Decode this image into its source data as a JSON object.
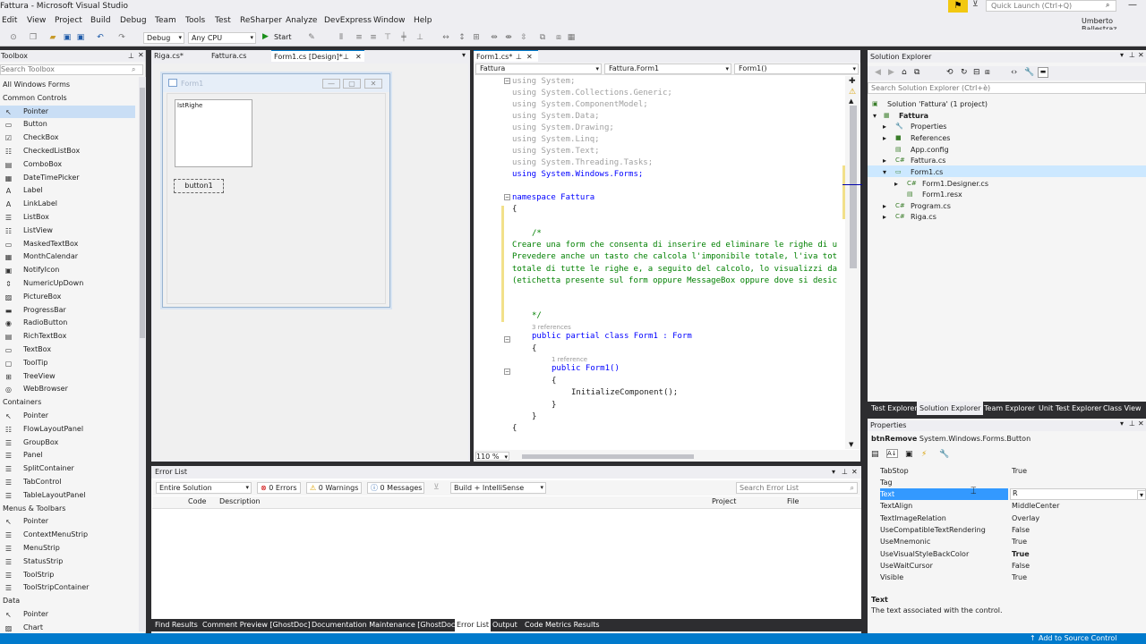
{
  "window": {
    "title": "Fattura - Microsoft Visual Studio",
    "quick_launch_placeholder": "Quick Launch (Ctrl+Q)",
    "user": "Umberto Ballestraz"
  },
  "menu": [
    "Edit",
    "View",
    "Project",
    "Build",
    "Debug",
    "Team",
    "Tools",
    "Test",
    "ReSharper",
    "Analyze",
    "DevExpress",
    "Window",
    "Help"
  ],
  "toolbar": {
    "config": "Debug",
    "platform": "Any CPU",
    "start": "Start"
  },
  "toolbox": {
    "title": "Toolbox",
    "search_placeholder": "Search Toolbox",
    "groups": [
      {
        "name": "All Windows Forms"
      },
      {
        "name": "Common Controls"
      }
    ],
    "common": [
      {
        "icon": "pointer",
        "label": "Pointer"
      },
      {
        "icon": "button",
        "label": "Button"
      },
      {
        "icon": "checkbox",
        "label": "CheckBox"
      },
      {
        "icon": "checkedlistbox",
        "label": "CheckedListBox"
      },
      {
        "icon": "combobox",
        "label": "ComboBox"
      },
      {
        "icon": "datetimepicker",
        "label": "DateTimePicker"
      },
      {
        "icon": "label",
        "label": "Label"
      },
      {
        "icon": "linklabel",
        "label": "LinkLabel"
      },
      {
        "icon": "listbox",
        "label": "ListBox"
      },
      {
        "icon": "listview",
        "label": "ListView"
      },
      {
        "icon": "maskedtextbox",
        "label": "MaskedTextBox"
      },
      {
        "icon": "monthcalendar",
        "label": "MonthCalendar"
      },
      {
        "icon": "notifyicon",
        "label": "NotifyIcon"
      },
      {
        "icon": "numericupdown",
        "label": "NumericUpDown"
      },
      {
        "icon": "picturebox",
        "label": "PictureBox"
      },
      {
        "icon": "progressbar",
        "label": "ProgressBar"
      },
      {
        "icon": "radiobutton",
        "label": "RadioButton"
      },
      {
        "icon": "richtextbox",
        "label": "RichTextBox"
      },
      {
        "icon": "textbox",
        "label": "TextBox"
      },
      {
        "icon": "tooltip",
        "label": "ToolTip"
      },
      {
        "icon": "treeview",
        "label": "TreeView"
      },
      {
        "icon": "webbrowser",
        "label": "WebBrowser"
      }
    ],
    "containers_label": "Containers",
    "containers": [
      "Pointer",
      "FlowLayoutPanel",
      "GroupBox",
      "Panel",
      "SplitContainer",
      "TabControl",
      "TableLayoutPanel"
    ],
    "menus_label": "Menus & Toolbars",
    "menus": [
      "Pointer",
      "ContextMenuStrip",
      "MenuStrip",
      "StatusStrip",
      "ToolStrip",
      "ToolStripContainer"
    ],
    "data_label": "Data",
    "data": [
      "Pointer",
      "Chart"
    ]
  },
  "designer_tabs": [
    "Riga.cs*",
    "Fattura.cs",
    "Form1.cs [Design]*"
  ],
  "form": {
    "title": "Form1",
    "listbox": "lstRighe",
    "button": "button1"
  },
  "editor": {
    "tab": "Form1.cs*",
    "nav": [
      "Fattura",
      "Fattura.Form1",
      "Form1()"
    ],
    "zoom": "110 %",
    "lines": [
      {
        "t": "using System;"
      },
      {
        "t": "using System.Collections.Generic;"
      },
      {
        "t": "using System.ComponentModel;"
      },
      {
        "t": "using System.Data;"
      },
      {
        "t": "using System.Drawing;"
      },
      {
        "t": "using System.Linq;"
      },
      {
        "t": "using System.Text;"
      },
      {
        "t": "using System.Threading.Tasks;"
      },
      {
        "t": "using System.Windows.Forms;"
      },
      {
        "t": "namespace Fattura"
      },
      {
        "t": "{"
      },
      {
        "t": "/*"
      },
      {
        "t": "Creare una form che consenta di inserire ed eliminare le righe di u"
      },
      {
        "t": "Prevedere anche un tasto che calcola l'imponibile totale, l'iva tot"
      },
      {
        "t": "totale di tutte le righe e, a seguito del calcolo, lo visualizzi da"
      },
      {
        "t": "(etichetta presente sul form oppure MessageBox oppure dove si desic"
      },
      {
        "t": "*/"
      },
      {
        "t": "3 references"
      },
      {
        "t": "public partial class Form1 : Form"
      },
      {
        "t": "{"
      },
      {
        "t": "1 reference"
      },
      {
        "t": "public Form1()"
      },
      {
        "t": "{"
      },
      {
        "t": "InitializeComponent();"
      },
      {
        "t": "}"
      },
      {
        "t": "}"
      }
    ]
  },
  "solution": {
    "title": "Solution Explorer",
    "search_placeholder": "Search Solution Explorer (Ctrl+è)",
    "tree": [
      "Solution 'Fattura' (1 project)",
      "Fattura",
      "Properties",
      "References",
      "App.config",
      "Fattura.cs",
      "Form1.cs",
      "Form1.Designer.cs",
      "Form1.resx",
      "Program.cs",
      "Riga.cs"
    ],
    "tabs": [
      "Test Explorer",
      "Solution Explorer",
      "Team Explorer",
      "Unit Test Explorer",
      "Class View"
    ]
  },
  "properties": {
    "title": "Properties",
    "object": "btnRemove",
    "object_type": "System.Windows.Forms.Button",
    "rows": [
      {
        "n": "TabStop",
        "v": "True"
      },
      {
        "n": "Tag",
        "v": ""
      },
      {
        "n": "Text",
        "v": "R"
      },
      {
        "n": "TextAlign",
        "v": "MiddleCenter"
      },
      {
        "n": "TextImageRelation",
        "v": "Overlay"
      },
      {
        "n": "UseCompatibleTextRendering",
        "v": "False"
      },
      {
        "n": "UseMnemonic",
        "v": "True"
      },
      {
        "n": "UseVisualStyleBackColor",
        "v": "True"
      },
      {
        "n": "UseWaitCursor",
        "v": "False"
      },
      {
        "n": "Visible",
        "v": "True"
      }
    ],
    "desc_title": "Text",
    "desc_body": "The text associated with the control."
  },
  "errorlist": {
    "title": "Error List",
    "scope": "Entire Solution",
    "errors": "0 Errors",
    "warnings": "0 Warnings",
    "messages": "0 Messages",
    "build": "Build + IntelliSense",
    "search_placeholder": "Search Error List",
    "cols": [
      "Code",
      "Description",
      "Project",
      "File"
    ]
  },
  "bottom_tabs": [
    "Find Results",
    "Comment Preview [GhostDoc]",
    "Documentation Maintenance [GhostDoc]",
    "Error List",
    "Output",
    "Code Metrics Results"
  ],
  "status": {
    "right": "Add to Source Control"
  }
}
